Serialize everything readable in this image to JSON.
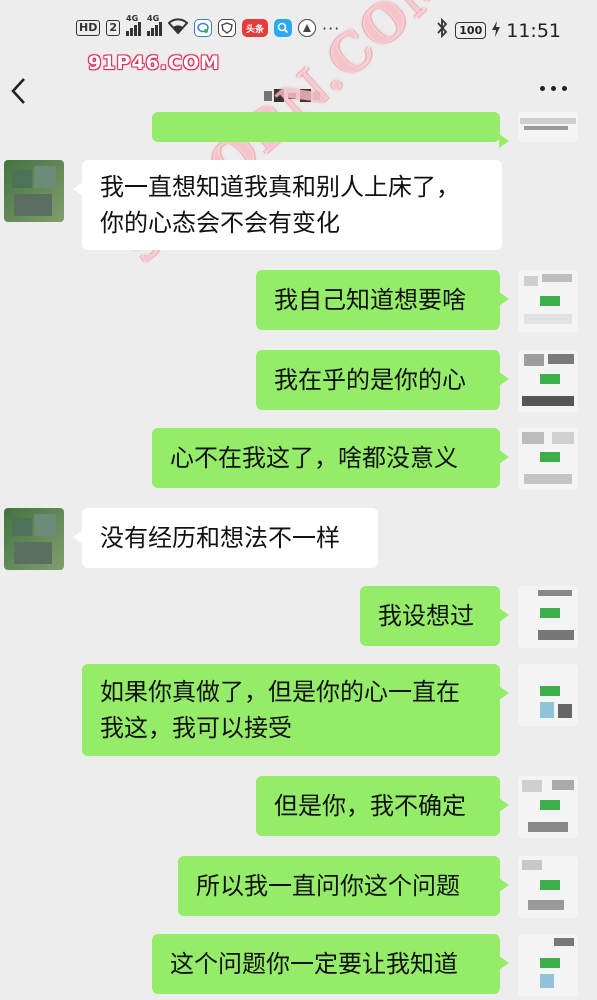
{
  "status_bar": {
    "hd_label": "HD",
    "sim_label": "2",
    "net1": "4G",
    "net2": "4G",
    "toutiao_label": "头条",
    "battery": "100",
    "time": "11:51",
    "more_dots": "···"
  },
  "watermark": {
    "top": "91P46.COM",
    "diagonal": "91PORN.COM"
  },
  "nav": {
    "title": ""
  },
  "messages": [
    {
      "sender": "me",
      "text": ""
    },
    {
      "sender": "other",
      "lines": [
        "我一直想知道我真和别人上床了，",
        "你的心态会不会有变化"
      ]
    },
    {
      "sender": "me",
      "text": "我自己知道想要啥"
    },
    {
      "sender": "me",
      "text": "我在乎的是你的心"
    },
    {
      "sender": "me",
      "text": "心不在我这了，啥都没意义"
    },
    {
      "sender": "other",
      "text": "没有经历和想法不一样"
    },
    {
      "sender": "me",
      "text": "我设想过"
    },
    {
      "sender": "me",
      "lines": [
        "如果你真做了，但是你的心一直在",
        "我这，我可以接受"
      ]
    },
    {
      "sender": "me",
      "text": "但是你，我不确定"
    },
    {
      "sender": "me",
      "text": "所以我一直问你这个问题"
    },
    {
      "sender": "me",
      "text": "这个问题你一定要让我知道"
    }
  ],
  "colors": {
    "background": "#ededed",
    "my_bubble": "#95ec69",
    "their_bubble": "#ffffff"
  }
}
